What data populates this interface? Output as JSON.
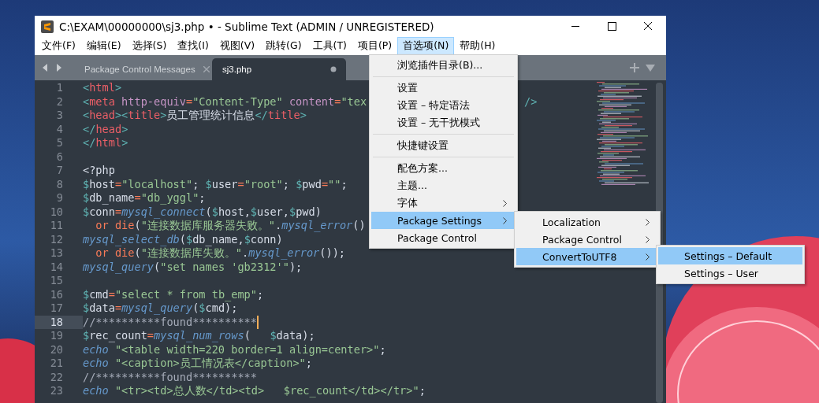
{
  "window": {
    "title": "C:\\EXAM\\00000000\\sj3.php • - Sublime Text (ADMIN / UNREGISTERED)"
  },
  "menu_bar": [
    {
      "label": "文件(F)",
      "selected": false
    },
    {
      "label": "编辑(E)",
      "selected": false
    },
    {
      "label": "选择(S)",
      "selected": false
    },
    {
      "label": "查找(I)",
      "selected": false
    },
    {
      "label": "视图(V)",
      "selected": false
    },
    {
      "label": "跳转(G)",
      "selected": false
    },
    {
      "label": "工具(T)",
      "selected": false
    },
    {
      "label": "项目(P)",
      "selected": false
    },
    {
      "label": "首选项(N)",
      "selected": true
    },
    {
      "label": "帮助(H)",
      "selected": false
    }
  ],
  "tabs": [
    {
      "label": "Package Control Messages",
      "selected": false,
      "dirty": false
    },
    {
      "label": "sj3.php",
      "selected": true,
      "dirty": true
    }
  ],
  "editor": {
    "lines": [
      {
        "number": "1",
        "current": false,
        "tokens": [
          {
            "kind": "br",
            "text": "<"
          },
          {
            "kind": "tg",
            "text": "html"
          },
          {
            "kind": "br",
            "text": ">"
          }
        ]
      },
      {
        "number": "2",
        "current": false,
        "tokens": [
          {
            "kind": "br",
            "text": "<"
          },
          {
            "kind": "tg",
            "text": "meta "
          },
          {
            "kind": "at",
            "text": "http-equiv"
          },
          {
            "kind": "op",
            "text": "="
          },
          {
            "kind": "st",
            "text": "\"Content-Type\" "
          },
          {
            "kind": "at",
            "text": "content"
          },
          {
            "kind": "op",
            "text": "="
          },
          {
            "kind": "st",
            "text": "\"tex"
          }
        ],
        "tail": [
          {
            "kind": "br",
            "text": "/>"
          }
        ]
      },
      {
        "number": "3",
        "current": false,
        "tokens": [
          {
            "kind": "br",
            "text": "<"
          },
          {
            "kind": "tg",
            "text": "head"
          },
          {
            "kind": "br",
            "text": "><"
          },
          {
            "kind": "tg",
            "text": "title"
          },
          {
            "kind": "br",
            "text": ">"
          },
          {
            "kind": "pl",
            "text": "员工管理统计信息"
          },
          {
            "kind": "br",
            "text": "</"
          },
          {
            "kind": "tg",
            "text": "title"
          },
          {
            "kind": "br",
            "text": ">"
          }
        ]
      },
      {
        "number": "4",
        "current": false,
        "tokens": [
          {
            "kind": "br",
            "text": "</"
          },
          {
            "kind": "tg",
            "text": "head"
          },
          {
            "kind": "br",
            "text": ">"
          }
        ]
      },
      {
        "number": "5",
        "current": false,
        "tokens": [
          {
            "kind": "br",
            "text": "</"
          },
          {
            "kind": "tg",
            "text": "html"
          },
          {
            "kind": "br",
            "text": ">"
          }
        ]
      },
      {
        "number": "6",
        "current": false
      },
      {
        "number": "7",
        "current": false,
        "tokens": [
          {
            "kind": "pl",
            "text": "<?php"
          }
        ]
      },
      {
        "number": "8",
        "current": false,
        "tokens": [
          {
            "kind": "dl",
            "text": "$"
          },
          {
            "kind": "pl",
            "text": "host"
          },
          {
            "kind": "op",
            "text": "="
          },
          {
            "kind": "st",
            "text": "\"localhost\""
          },
          {
            "kind": "pl",
            "text": "; "
          },
          {
            "kind": "dl",
            "text": "$"
          },
          {
            "kind": "pl",
            "text": "user"
          },
          {
            "kind": "op",
            "text": "="
          },
          {
            "kind": "st",
            "text": "\"root\""
          },
          {
            "kind": "pl",
            "text": "; "
          },
          {
            "kind": "dl",
            "text": "$"
          },
          {
            "kind": "pl",
            "text": "pwd"
          },
          {
            "kind": "op",
            "text": "="
          },
          {
            "kind": "st",
            "text": "\"\""
          },
          {
            "kind": "pl",
            "text": ";"
          }
        ]
      },
      {
        "number": "9",
        "current": false,
        "tokens": [
          {
            "kind": "dl",
            "text": "$"
          },
          {
            "kind": "pl",
            "text": "db_name"
          },
          {
            "kind": "op",
            "text": "="
          },
          {
            "kind": "st",
            "text": "\"db_yggl\""
          },
          {
            "kind": "pl",
            "text": ";"
          }
        ]
      },
      {
        "number": "10",
        "current": false,
        "tokens": [
          {
            "kind": "dl",
            "text": "$"
          },
          {
            "kind": "pl",
            "text": "conn"
          },
          {
            "kind": "op",
            "text": "="
          },
          {
            "kind": "fn",
            "text": "mysql_connect"
          },
          {
            "kind": "pl",
            "text": "("
          },
          {
            "kind": "dl",
            "text": "$"
          },
          {
            "kind": "pl",
            "text": "host,"
          },
          {
            "kind": "dl",
            "text": "$"
          },
          {
            "kind": "pl",
            "text": "user,"
          },
          {
            "kind": "dl",
            "text": "$"
          },
          {
            "kind": "pl",
            "text": "pwd)"
          }
        ]
      },
      {
        "number": "11",
        "current": false,
        "tokens": [
          {
            "kind": "kw",
            "text": "  or die"
          },
          {
            "kind": "pl",
            "text": "("
          },
          {
            "kind": "st",
            "text": "\"连接数据库服务器失败。\""
          },
          {
            "kind": "pl",
            "text": "."
          },
          {
            "kind": "fn",
            "text": "mysql_error"
          },
          {
            "kind": "pl",
            "text": "()"
          }
        ]
      },
      {
        "number": "12",
        "current": false,
        "tokens": [
          {
            "kind": "fn",
            "text": "mysql_select_db"
          },
          {
            "kind": "pl",
            "text": "("
          },
          {
            "kind": "dl",
            "text": "$"
          },
          {
            "kind": "pl",
            "text": "db_name,"
          },
          {
            "kind": "dl",
            "text": "$"
          },
          {
            "kind": "pl",
            "text": "conn)"
          }
        ]
      },
      {
        "number": "13",
        "current": false,
        "tokens": [
          {
            "kind": "kw",
            "text": "  or die"
          },
          {
            "kind": "pl",
            "text": "("
          },
          {
            "kind": "st",
            "text": "\"连接数据库失败。\""
          },
          {
            "kind": "pl",
            "text": "."
          },
          {
            "kind": "fn",
            "text": "mysql_error"
          },
          {
            "kind": "pl",
            "text": "());"
          }
        ]
      },
      {
        "number": "14",
        "current": false,
        "tokens": [
          {
            "kind": "fn",
            "text": "mysql_query"
          },
          {
            "kind": "pl",
            "text": "("
          },
          {
            "kind": "st",
            "text": "\"set names 'gb2312'\""
          },
          {
            "kind": "pl",
            "text": ");"
          }
        ]
      },
      {
        "number": "15",
        "current": false
      },
      {
        "number": "16",
        "current": false,
        "tokens": [
          {
            "kind": "dl",
            "text": "$"
          },
          {
            "kind": "pl",
            "text": "cmd"
          },
          {
            "kind": "op",
            "text": "="
          },
          {
            "kind": "st",
            "text": "\"select * from tb_emp\""
          },
          {
            "kind": "pl",
            "text": ";"
          }
        ]
      },
      {
        "number": "17",
        "current": false,
        "tokens": [
          {
            "kind": "dl",
            "text": "$"
          },
          {
            "kind": "pl",
            "text": "data"
          },
          {
            "kind": "op",
            "text": "="
          },
          {
            "kind": "fn",
            "text": "mysql_query"
          },
          {
            "kind": "pl",
            "text": "("
          },
          {
            "kind": "dl",
            "text": "$"
          },
          {
            "kind": "pl",
            "text": "cmd);"
          }
        ]
      },
      {
        "number": "18",
        "current": true,
        "tokens": [
          {
            "kind": "cm",
            "text": "//**********found**********"
          }
        ]
      },
      {
        "number": "19",
        "current": false,
        "tokens": [
          {
            "kind": "dl",
            "text": "$"
          },
          {
            "kind": "pl",
            "text": "rec_count"
          },
          {
            "kind": "op",
            "text": "="
          },
          {
            "kind": "fn",
            "text": "mysql_num_rows"
          },
          {
            "kind": "pl",
            "text": "(   "
          },
          {
            "kind": "dl",
            "text": "$"
          },
          {
            "kind": "pl",
            "text": "data);"
          }
        ]
      },
      {
        "number": "20",
        "current": false,
        "tokens": [
          {
            "kind": "fn",
            "text": "echo "
          },
          {
            "kind": "st",
            "text": "\"<table width=220 border=1 align=center>\""
          },
          {
            "kind": "pl",
            "text": ";"
          }
        ]
      },
      {
        "number": "21",
        "current": false,
        "tokens": [
          {
            "kind": "fn",
            "text": "echo "
          },
          {
            "kind": "st",
            "text": "\"<caption>员工情况表</caption>\""
          },
          {
            "kind": "pl",
            "text": ";"
          }
        ]
      },
      {
        "number": "22",
        "current": false,
        "tokens": [
          {
            "kind": "cm",
            "text": "//**********found**********"
          }
        ]
      },
      {
        "number": "23",
        "current": false,
        "tokens": [
          {
            "kind": "fn",
            "text": "echo "
          },
          {
            "kind": "st",
            "text": "\"<tr><td>总人数</td><td>   $rec_count</td></tr>\""
          },
          {
            "kind": "pl",
            "text": ";"
          }
        ]
      }
    ]
  },
  "menus": [
    {
      "groups": [
        [
          {
            "label": "浏览插件目录(B)...",
            "submenu": false,
            "selected": false
          }
        ],
        [
          {
            "label": "设置",
            "submenu": false,
            "selected": false
          },
          {
            "label": "设置 – 特定语法",
            "submenu": false,
            "selected": false
          },
          {
            "label": "设置 – 无干扰模式",
            "submenu": false,
            "selected": false
          }
        ],
        [
          {
            "label": "快捷键设置",
            "submenu": false,
            "selected": false
          }
        ],
        [
          {
            "label": "配色方案...",
            "submenu": false,
            "selected": false
          },
          {
            "label": "主题...",
            "submenu": false,
            "selected": false
          },
          {
            "label": "字体",
            "submenu": true,
            "selected": false
          },
          {
            "label": "Package Settings",
            "submenu": true,
            "selected": true
          },
          {
            "label": "Package Control",
            "submenu": false,
            "selected": false
          }
        ]
      ]
    },
    {
      "groups": [
        [
          {
            "label": "Localization",
            "submenu": true,
            "selected": false
          },
          {
            "label": "Package Control",
            "submenu": true,
            "selected": false
          },
          {
            "label": "ConvertToUTF8",
            "submenu": true,
            "selected": true
          }
        ]
      ]
    },
    {
      "groups": [
        [
          {
            "label": "Settings – Default",
            "submenu": false,
            "selected": true
          },
          {
            "label": "Settings – User",
            "submenu": false,
            "selected": false
          }
        ]
      ]
    }
  ]
}
